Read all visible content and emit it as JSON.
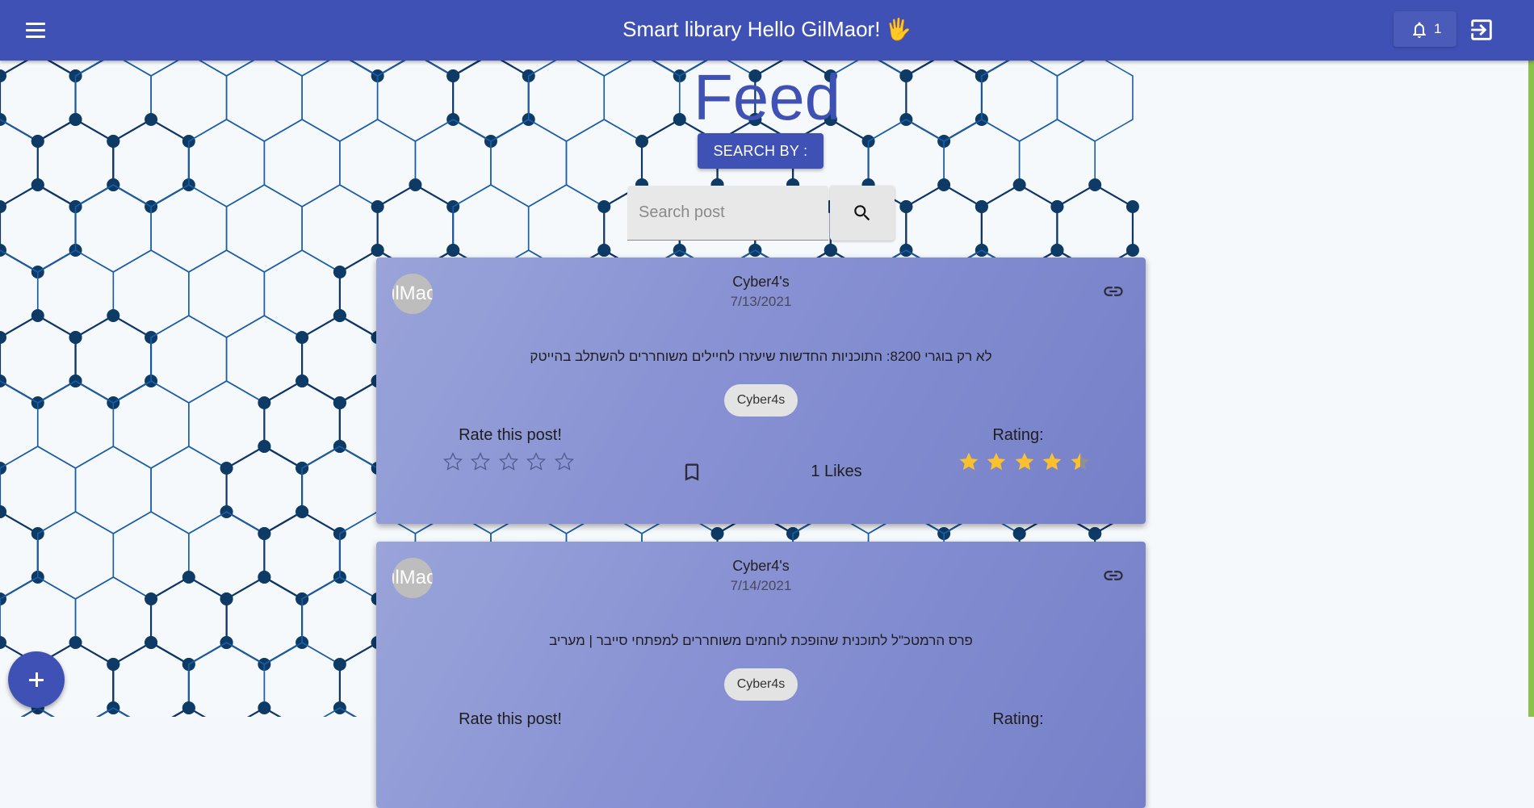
{
  "header": {
    "title": "Smart library Hello GilMaor!",
    "title_emoji": "🖐",
    "notification_count": "1"
  },
  "page": {
    "title": "Feed",
    "search_by_label": "SEARCH BY :",
    "search_placeholder": "Search post"
  },
  "posts": [
    {
      "avatar_text": "ilMaor",
      "author": "Cyber4's",
      "date": "7/13/2021",
      "text": "לא רק בוגרי 8200: התוכניות החדשות שיעזרו לחיילים משוחררים להשתלב בהייטק",
      "tag": "Cyber4s",
      "rate_label": "Rate this post!",
      "likes": "1 Likes",
      "rating_label": "Rating:",
      "rating_value": 4.5
    },
    {
      "avatar_text": "ilMaor",
      "author": "Cyber4's",
      "date": "7/14/2021",
      "text": "פרס הרמטכ\"ל לתוכנית שהופכת לוחמים משוחררים למפתחי סייבר | מעריב",
      "tag": "Cyber4s",
      "rate_label": "Rate this post!",
      "likes": "",
      "rating_label": "Rating:",
      "rating_value": 0
    }
  ],
  "colors": {
    "primary": "#3f51b5",
    "card": "#8791d3",
    "star": "#fbc02d",
    "hex_line": "#1a5ea8",
    "hex_node": "#0d3b66"
  },
  "icons": [
    "menu-icon",
    "hand-emoji-icon",
    "bell-icon",
    "logout-icon",
    "search-icon",
    "link-icon",
    "bookmark-icon",
    "star-outline-icon",
    "star-filled-icon",
    "plus-icon"
  ]
}
